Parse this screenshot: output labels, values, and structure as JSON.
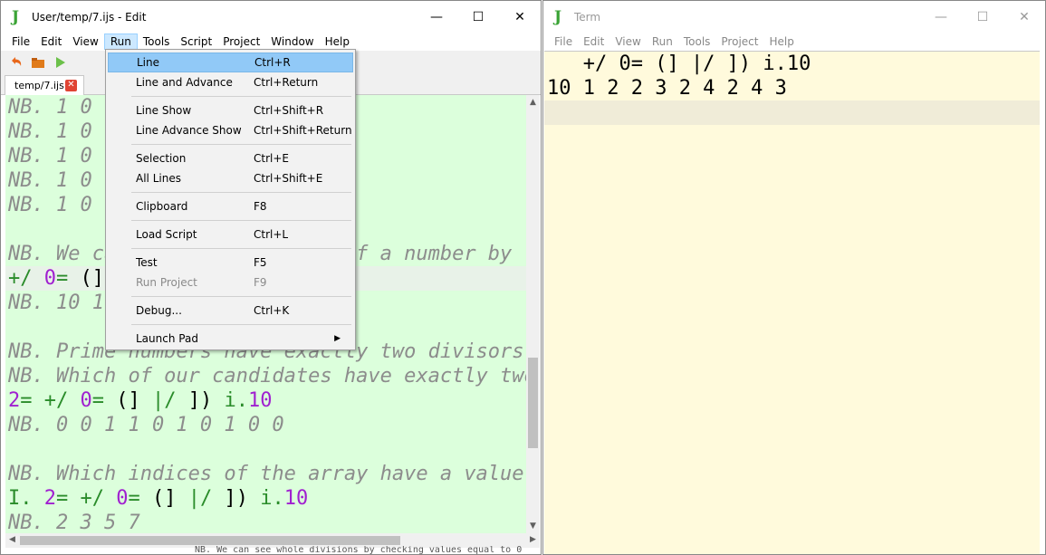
{
  "edit_window": {
    "title": "User/temp/7.ijs - Edit",
    "menus": [
      "File",
      "Edit",
      "View",
      "Run",
      "Tools",
      "Script",
      "Project",
      "Window",
      "Help"
    ],
    "open_menu": "Run",
    "tab_label": "temp/7.ijs",
    "lines": [
      {
        "t": "NB. 1 0 0",
        "k": "nb"
      },
      {
        "t": "NB. 1 0 0",
        "k": "nb"
      },
      {
        "t": "NB. 1 0 0",
        "k": "nb"
      },
      {
        "t": "NB. 1 0 0",
        "k": "nb"
      },
      {
        "t": "NB. 1 0 0",
        "k": "nb"
      },
      {
        "t": "",
        "k": "nb"
      },
      {
        "t": "NB. We ca                   of a number by",
        "k": "nb"
      },
      {
        "t": "+/ 0= (]",
        "k": "code"
      },
      {
        "t": "NB. 10 1",
        "k": "nb"
      },
      {
        "t": "",
        "k": "nb"
      },
      {
        "t": "NB. Prime numbers have exactly two divisors:",
        "k": "nb"
      },
      {
        "t": "NB. Which of our candidates have exactly two",
        "k": "nb"
      },
      {
        "t": "2= +/ 0= (] |/ ]) i.10",
        "k": "code"
      },
      {
        "t": "NB. 0 0 1 1 0 1 0 1 0 0",
        "k": "nb"
      },
      {
        "t": "",
        "k": "nb"
      },
      {
        "t": "NB. Which indices of the array have a value",
        "k": "nb"
      },
      {
        "t": "I. 2= +/ 0= (] |/ ]) i.10",
        "k": "code"
      },
      {
        "t": "NB. 2 3 5 7",
        "k": "nb"
      }
    ]
  },
  "run_menu": {
    "items": [
      {
        "label": "Line",
        "shortcut": "Ctrl+R"
      },
      {
        "label": "Line and Advance",
        "shortcut": "Ctrl+Return"
      },
      {
        "label": "Line Show",
        "shortcut": "Ctrl+Shift+R"
      },
      {
        "label": "Line Advance Show",
        "shortcut": "Ctrl+Shift+Return"
      },
      {
        "label": "Selection",
        "shortcut": "Ctrl+E"
      },
      {
        "label": "All Lines",
        "shortcut": "Ctrl+Shift+E"
      },
      {
        "label": "Clipboard",
        "shortcut": "F8"
      },
      {
        "label": "Load Script",
        "shortcut": "Ctrl+L"
      },
      {
        "label": "Test",
        "shortcut": "F5"
      },
      {
        "label": "Run Project",
        "shortcut": "F9"
      },
      {
        "label": "Debug...",
        "shortcut": "Ctrl+K"
      },
      {
        "label": "Launch Pad",
        "shortcut": ""
      }
    ]
  },
  "term_window": {
    "title": "Term",
    "menus": [
      "File",
      "Edit",
      "View",
      "Run",
      "Tools",
      "Project",
      "Help"
    ],
    "lines": [
      "   +/ 0= (] |/ ]) i.10",
      "10 1 2 2 3 2 4 2 4 3",
      ""
    ]
  },
  "background_text": "NB. We can see whole divisions by checking values equal to 0",
  "colors": {
    "editor_bg": "#dcffdc",
    "term_bg": "#fffadc",
    "menu_highlight": "#91c9f7",
    "comment": "#8c8c8c",
    "verb": "#2a8c2a",
    "noun": "#a020d0"
  }
}
